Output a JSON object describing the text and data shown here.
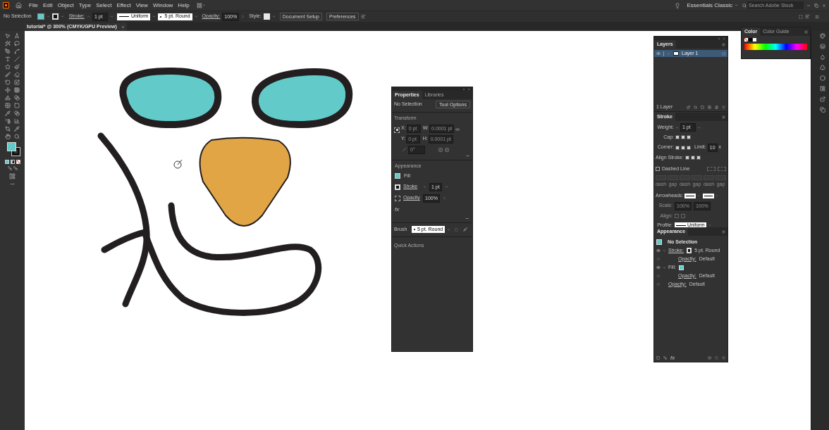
{
  "menu_bar": {
    "items": [
      "File",
      "Edit",
      "Object",
      "Type",
      "Select",
      "Effect",
      "View",
      "Window",
      "Help"
    ],
    "workspace": "Essentials Classic",
    "search": {
      "placeholder": "Search Adobe Stock"
    }
  },
  "control_bar": {
    "selection": "No Selection",
    "stroke_label": "Stroke:",
    "stroke_weight": "1 pt",
    "profile": "Uniform",
    "brush": "5 pt. Round",
    "opacity_label": "Opacity:",
    "opacity": "100%",
    "style_label": "Style:",
    "buttons": [
      "Document Setup",
      "Preferences"
    ]
  },
  "document_tab": {
    "title": "tutorial* @ 300% (CMYK/GPU Preview)"
  },
  "properties_panel": {
    "tabs": [
      {
        "label": "Properties",
        "selected": true
      },
      {
        "label": "Libraries",
        "selected": false
      }
    ],
    "selection": "No Selection",
    "tool_options": "Tool Options",
    "transform": {
      "title": "Transform",
      "fields": [
        {
          "label": "X:",
          "value": "0 pt"
        },
        {
          "label": "W:",
          "value": "0.0001 pt"
        },
        {
          "label": "Y:",
          "value": "0 pt"
        },
        {
          "label": "H:",
          "value": "0.0001 pt"
        }
      ],
      "angle": "0°"
    },
    "appearance": {
      "title": "Appearance",
      "fill": "Fill",
      "stroke": "Stroke",
      "stroke_weight": "1 pt",
      "opacity": "Opacity",
      "opacity_value": "100%",
      "fx": "fx"
    },
    "brush_label": "Brush",
    "brush": "5 pt. Round",
    "quick_actions": "Quick Actions"
  },
  "layers_panel": {
    "title": "Layers",
    "layers": [
      {
        "name": "Layer 1",
        "selected": true
      }
    ],
    "count": "1 Layer"
  },
  "stroke_panel": {
    "title": "Stroke",
    "weight_label": "Weight:",
    "weight": "1 pt",
    "cap_label": "Cap:",
    "corner_label": "Corner:",
    "limit_label": "Limit:",
    "limit": "10",
    "limit_unit": "x",
    "align_label": "Align Stroke:",
    "dashed_line": {
      "label": "Dashed Line",
      "checked": false
    },
    "dash_labels": [
      "dash",
      "gap",
      "dash",
      "gap",
      "dash",
      "gap"
    ],
    "arrowheads_label": "Arrowheads:",
    "scale_label": "Scale:",
    "scales": [
      "100%",
      "100%"
    ],
    "align_arrow_label": "Align:",
    "profile_label": "Profile:",
    "profile": "Uniform"
  },
  "appearance_panel": {
    "title": "Appearance",
    "selection": "No Selection",
    "rows": [
      {
        "kind": "stroke",
        "label": "Stroke:",
        "value": "5 pt. Round",
        "expanded": true,
        "children": [
          {
            "kind": "opacity",
            "label": "Opacity:",
            "value": "Default"
          }
        ]
      },
      {
        "kind": "fill",
        "label": "Fill:",
        "expanded": true,
        "children": [
          {
            "kind": "opacity",
            "label": "Opacity:",
            "value": "Default"
          }
        ]
      },
      {
        "kind": "opacity",
        "label": "Opacity:",
        "value": "Default"
      }
    ],
    "fx": "fx"
  },
  "color_panel": {
    "tabs": [
      {
        "label": "Color",
        "selected": true
      },
      {
        "label": "Color Guide",
        "selected": false
      }
    ]
  }
}
